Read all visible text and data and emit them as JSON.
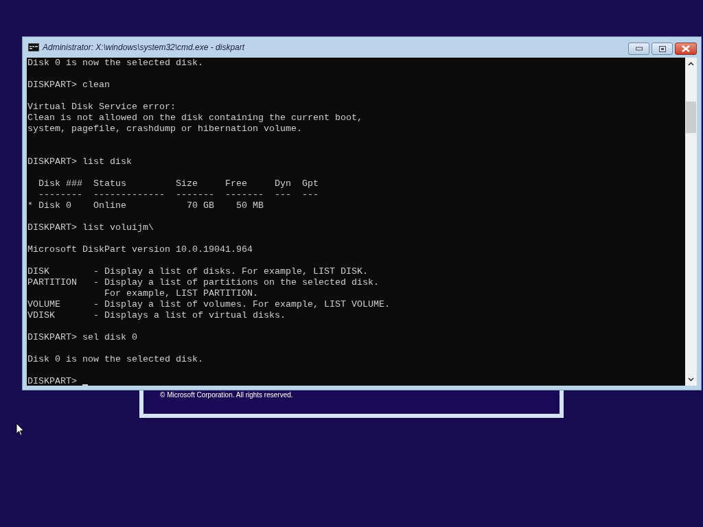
{
  "background_window": {
    "copyright": "© Microsoft Corporation. All rights reserved."
  },
  "window": {
    "title": "Administrator: X:\\windows\\system32\\cmd.exe - diskpart"
  },
  "console": {
    "lines": [
      {
        "kind": "text",
        "text": "Disk 0 is now the selected disk."
      },
      {
        "kind": "blank"
      },
      {
        "kind": "text",
        "text": "DISKPART> clean"
      },
      {
        "kind": "blank"
      },
      {
        "kind": "text",
        "text": "Virtual Disk Service error:"
      },
      {
        "kind": "text",
        "text": "Clean is not allowed on the disk containing the current boot,"
      },
      {
        "kind": "text",
        "text": "system, pagefile, crashdump or hibernation volume."
      },
      {
        "kind": "blank"
      },
      {
        "kind": "blank"
      },
      {
        "kind": "text",
        "text": "DISKPART> list disk"
      },
      {
        "kind": "blank"
      },
      {
        "kind": "text",
        "text": "  Disk ###  Status         Size     Free     Dyn  Gpt"
      },
      {
        "kind": "text",
        "text": "  --------  -------------  -------  -------  ---  ---"
      },
      {
        "kind": "text",
        "text": "* Disk 0    Online           70 GB    50 MB"
      },
      {
        "kind": "blank"
      },
      {
        "kind": "text",
        "text": "DISKPART> list voluijm\\"
      },
      {
        "kind": "blank"
      },
      {
        "kind": "text",
        "text": "Microsoft DiskPart version 10.0.19041.964"
      },
      {
        "kind": "blank"
      },
      {
        "kind": "text",
        "text": "DISK        - Display a list of disks. For example, LIST DISK."
      },
      {
        "kind": "text",
        "text": "PARTITION   - Display a list of partitions on the selected disk."
      },
      {
        "kind": "text",
        "text": "              For example, LIST PARTITION."
      },
      {
        "kind": "text",
        "text": "VOLUME      - Display a list of volumes. For example, LIST VOLUME."
      },
      {
        "kind": "text",
        "text": "VDISK       - Displays a list of virtual disks."
      },
      {
        "kind": "blank"
      },
      {
        "kind": "text",
        "text": "DISKPART> sel disk 0"
      },
      {
        "kind": "blank"
      },
      {
        "kind": "text",
        "text": "Disk 0 is now the selected disk."
      },
      {
        "kind": "blank"
      },
      {
        "kind": "prompt",
        "text": "DISKPART>"
      }
    ]
  }
}
